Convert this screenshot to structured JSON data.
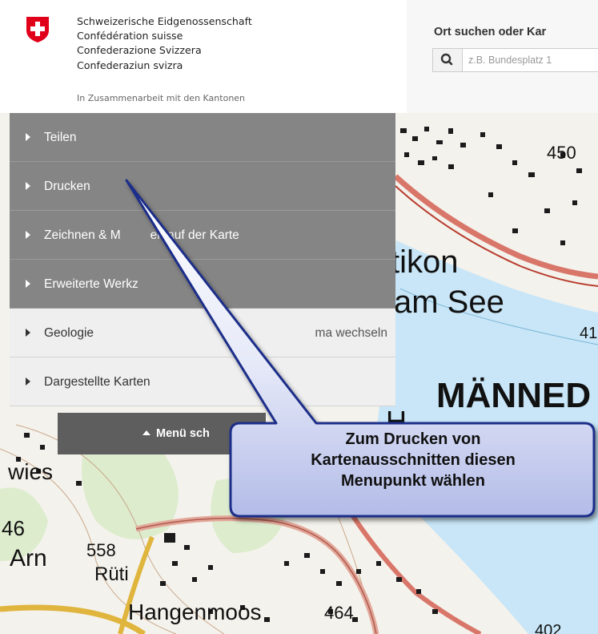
{
  "header": {
    "confederation_lines": [
      "Schweizerische Eidgenossenschaft",
      "Confédération suisse",
      "Confederazione Svizzera",
      "Confederaziun svizra"
    ],
    "cantons": "In Zusammenarbeit mit den Kantonen",
    "search_label": "Ort suchen oder Kar",
    "search_placeholder": "z.B. Bundesplatz 1"
  },
  "menu": {
    "items": [
      {
        "label": "Teilen"
      },
      {
        "label": "Drucken"
      },
      {
        "label": "Zeichnen & M"
      },
      {
        "label": "Erweiterte Werkz"
      },
      {
        "label": "Geologie",
        "right_label": "ma wechseln"
      },
      {
        "label": "Dargestellte Karten"
      }
    ],
    "drawing_suffix": "en auf der Karte",
    "close_label": "Menü sch"
  },
  "map": {
    "labels": [
      "450",
      "tikon",
      "am See",
      "41",
      "MÄNNED",
      "H",
      "wies",
      "46",
      "Arn",
      "558",
      "Rüti",
      "Hangenmoos",
      "464",
      "402"
    ]
  },
  "callout": {
    "lines": [
      "Zum Drucken von",
      "Kartenausschnitten diesen",
      "Menupunkt wählen"
    ]
  },
  "colors": {
    "swiss_red": "#e1001a",
    "menu_dark": "#858585",
    "menu_light": "#efefef",
    "callout_blue": "#1b2e8a"
  }
}
